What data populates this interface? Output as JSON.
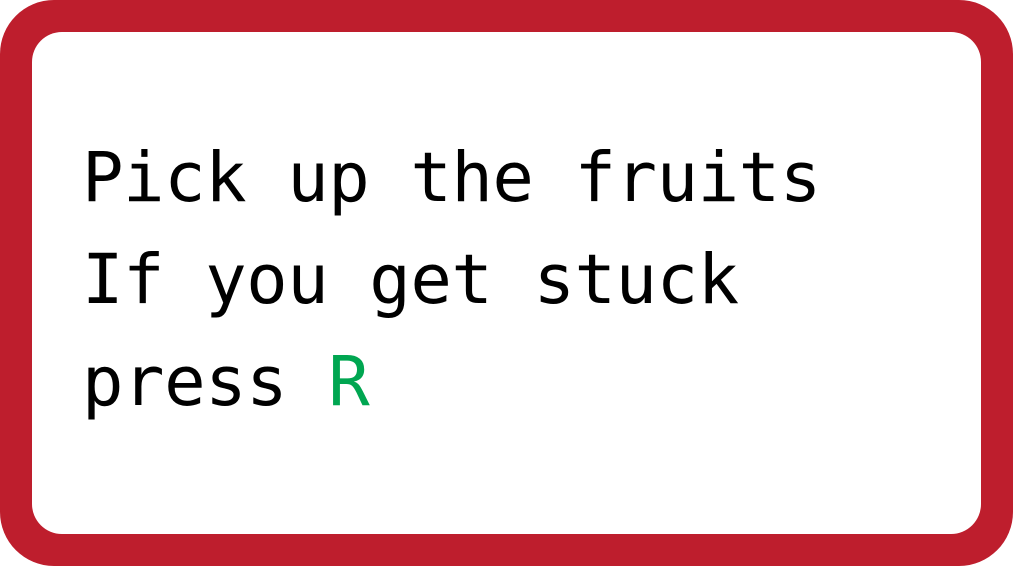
{
  "colors": {
    "frame": "#BE1E2D",
    "panel": "#FFFFFF",
    "text": "#000000",
    "key": "#00A651"
  },
  "instructions": {
    "line1": "Pick up the fruits",
    "line2": "If you get stuck",
    "line3_prefix": "press ",
    "line3_key": "R"
  }
}
